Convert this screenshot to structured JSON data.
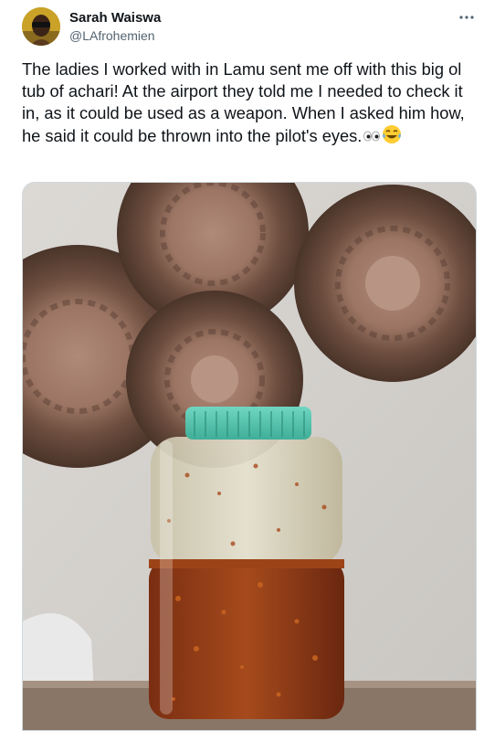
{
  "tweet": {
    "author": {
      "display_name": "Sarah Waiswa",
      "handle": "@LAfrohemien",
      "avatar_icon": "user-avatar"
    },
    "more_icon": "more-horizontal-icon",
    "text": "The ladies I worked with in Lamu sent me off with this big ol tub of achari! At the airport they told me I needed to check it in, as it could be used as a weapon. When I asked him how, he said it could be thrown into the pilot's eyes.",
    "emojis": [
      "eyes-emoji",
      "tears-of-joy-emoji"
    ],
    "photo_subject": "jar-of-achari-photo"
  },
  "colors": {
    "text_primary": "#0f1419",
    "text_secondary": "#536471",
    "border": "#cfd9de"
  }
}
